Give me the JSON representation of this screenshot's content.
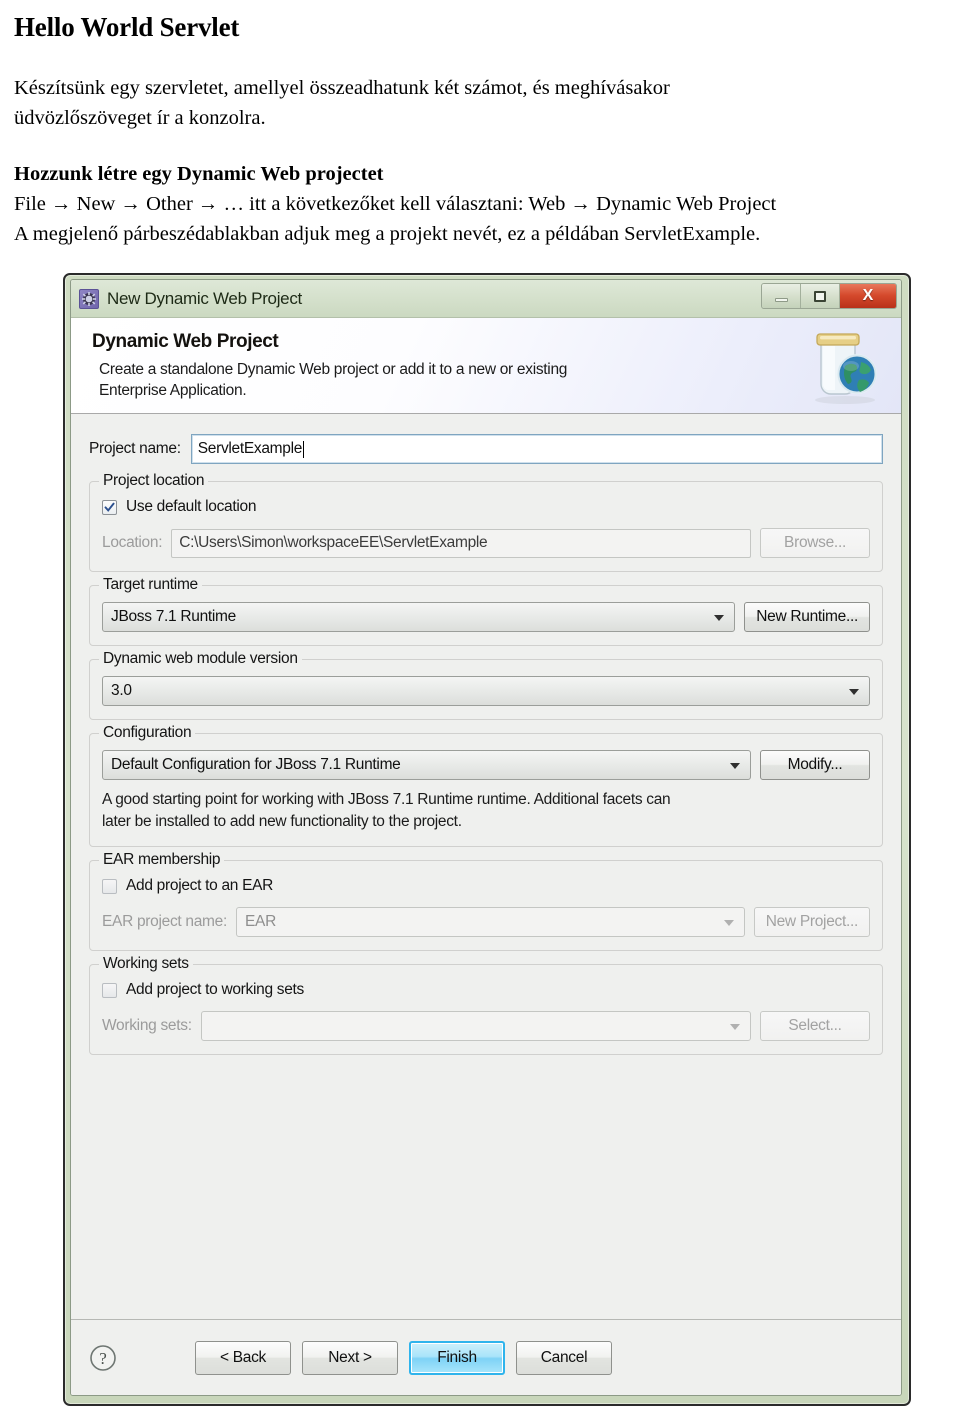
{
  "document": {
    "title": "Hello World Servlet",
    "intro_line_1": "Készítsünk egy szervletet, amellyel összeadhatunk két számot, és meghívásakor",
    "intro_line_2": "üdvözlőszöveget ír a konzolra.",
    "section_heading": "Hozzunk létre egy Dynamic Web projectet",
    "steps_line_1": "File → New → Other → … itt a következőket kell választani: Web → Dynamic Web Project",
    "steps_line_2": "A megjelenő párbeszédablakban adjuk meg a projekt nevét, ez a példában ServletExample."
  },
  "dialog": {
    "window_title": "New Dynamic Web Project",
    "window_icon": "eclipse-wizard-icon",
    "controls": {
      "minimize": "minimize-icon",
      "maximize": "maximize-icon",
      "close": "X"
    },
    "header": {
      "heading": "Dynamic Web Project",
      "description_line_1": "Create a standalone Dynamic Web project or add it to a new or existing",
      "description_line_2": "Enterprise Application.",
      "banner_icon": "web-project-jar-globe-icon"
    },
    "project_name": {
      "label": "Project name:",
      "value": "ServletExample",
      "placeholder": ""
    },
    "project_location": {
      "group_title": "Project location",
      "use_default_label": "Use default location",
      "use_default_checked": true,
      "location_label": "Location:",
      "location_value": "C:\\Users\\Simon\\workspaceEE\\ServletExample",
      "browse_label": "Browse..."
    },
    "target_runtime": {
      "group_title": "Target runtime",
      "selected": "JBoss 7.1 Runtime",
      "new_runtime_label": "New Runtime..."
    },
    "module_version": {
      "group_title": "Dynamic web module version",
      "selected": "3.0"
    },
    "configuration": {
      "group_title": "Configuration",
      "selected": "Default Configuration for JBoss 7.1 Runtime",
      "modify_label": "Modify...",
      "help_line_1": "A good starting point for working with JBoss 7.1 Runtime runtime. Additional facets can",
      "help_line_2": "later be installed to add new functionality to the project."
    },
    "ear_membership": {
      "group_title": "EAR membership",
      "add_to_ear_label": "Add project to an EAR",
      "add_to_ear_checked": false,
      "ear_project_name_label": "EAR project name:",
      "ear_project_name_value": "EAR",
      "new_project_label": "New Project..."
    },
    "working_sets": {
      "group_title": "Working sets",
      "add_to_working_sets_label": "Add project to working sets",
      "add_to_working_sets_checked": false,
      "working_sets_label": "Working sets:",
      "working_sets_value": "",
      "select_label": "Select..."
    },
    "buttons": {
      "help": "help-icon",
      "back": "< Back",
      "next": "Next >",
      "finish": "Finish",
      "cancel": "Cancel",
      "default_button": "Finish"
    },
    "colors": {
      "window_frame": "#cfdcc2",
      "dialog_body": "#eff0ee",
      "focus_border": "#7fa5c0",
      "default_button_border": "#2fb4ec",
      "close_button": "#d4492c"
    }
  }
}
